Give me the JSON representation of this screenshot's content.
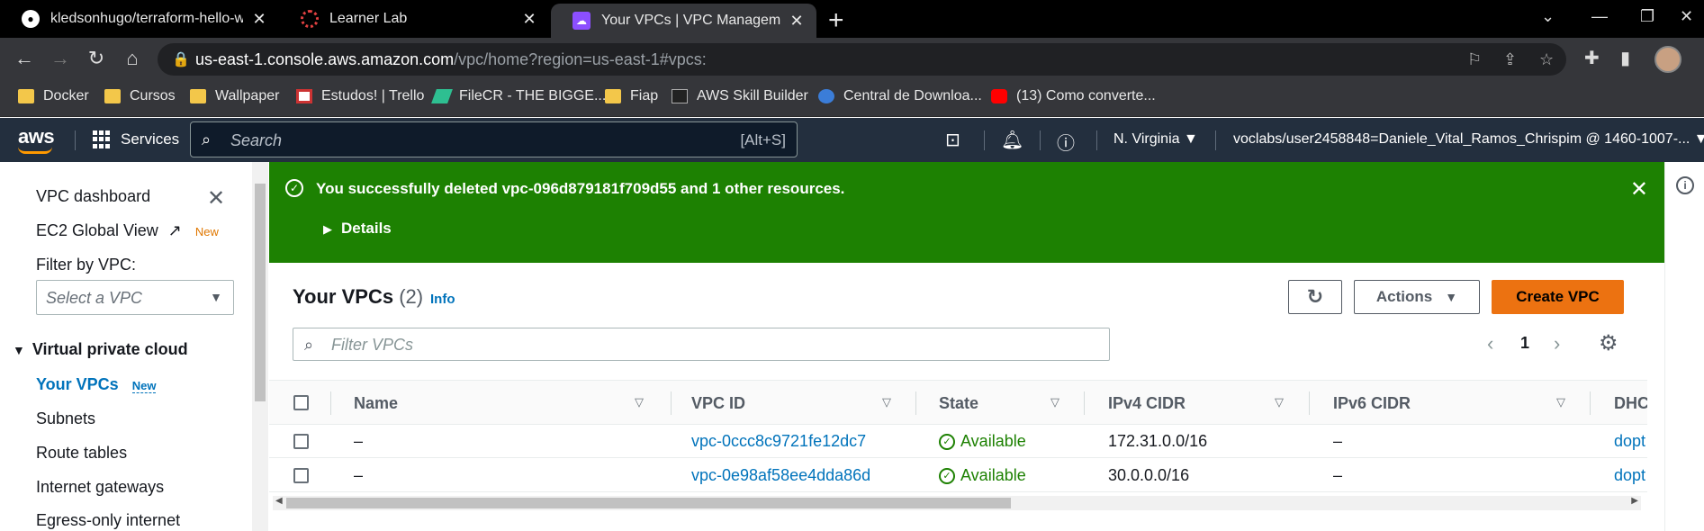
{
  "browser": {
    "tabs": [
      {
        "title": "kledsonhugo/terraform-hello-wo",
        "icon": "github-icon"
      },
      {
        "title": "Learner Lab",
        "icon": "learner-lab-icon"
      },
      {
        "title": "Your VPCs | VPC Management Co",
        "icon": "vpc-icon",
        "active": true
      }
    ],
    "url_host": "us-east-1.console.aws.amazon.com",
    "url_path": "/vpc/home?region=us-east-1#vpcs:",
    "bookmarks": [
      "Docker",
      "Cursos",
      "Wallpaper",
      "Estudos! | Trello",
      "FileCR - THE BIGGE...",
      "Fiap",
      "AWS Skill Builder",
      "Central de Downloa...",
      "(13) Como converte..."
    ]
  },
  "aws_nav": {
    "logo": "aws",
    "services": "Services",
    "search_placeholder": "Search",
    "search_shortcut": "[Alt+S]",
    "region": "N. Virginia",
    "account": "voclabs/user2458848=Daniele_Vital_Ramos_Chrispim @ 1460-1007-..."
  },
  "sidebar": {
    "dashboard": "VPC dashboard",
    "ec2_global_view": "EC2 Global View",
    "new_badge": "New",
    "filter_label": "Filter by VPC:",
    "filter_placeholder": "Select a VPC",
    "section": "Virtual private cloud",
    "items": [
      "Your VPCs",
      "Subnets",
      "Route tables",
      "Internet gateways",
      "Egress-only internet"
    ]
  },
  "flash": {
    "message": "You successfully deleted vpc-096d879181f709d55 and 1 other resources.",
    "details": "Details"
  },
  "main": {
    "title": "Your VPCs",
    "count": "(2)",
    "info": "Info",
    "actions": "Actions",
    "create": "Create VPC",
    "filter_placeholder": "Filter VPCs",
    "page": "1",
    "columns": [
      "Name",
      "VPC ID",
      "State",
      "IPv4 CIDR",
      "IPv6 CIDR",
      "DHC"
    ],
    "rows": [
      {
        "name": "–",
        "vpc_id": "vpc-0ccc8c9721fe12dc7",
        "state": "Available",
        "ipv4": "172.31.0.0/16",
        "ipv6": "–",
        "dhcp": "dopt"
      },
      {
        "name": "–",
        "vpc_id": "vpc-0e98af58ee4dda86d",
        "state": "Available",
        "ipv4": "30.0.0.0/16",
        "ipv6": "–",
        "dhcp": "dopt"
      }
    ]
  },
  "colors": {
    "aws_nav": "#232f3e",
    "flash_success": "#1d8102",
    "primary_button": "#ec7211",
    "link": "#0073bb"
  }
}
